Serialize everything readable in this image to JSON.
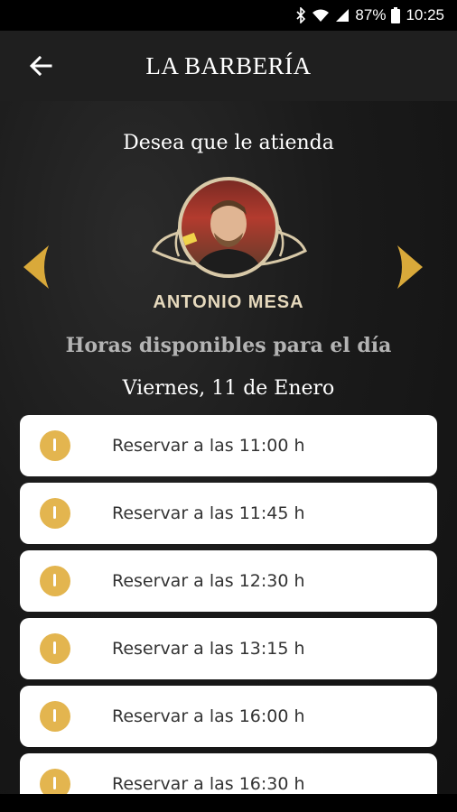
{
  "status_bar": {
    "battery": "87%",
    "time": "10:25",
    "icons": [
      "bluetooth-icon",
      "wifi-icon",
      "signal-icon",
      "battery-icon"
    ]
  },
  "app_bar": {
    "title": "LA BARBERÍA",
    "back_icon": "arrow-left-icon"
  },
  "barber_select": {
    "prompt": "Desea que le atienda",
    "name": "ANTONIO MESA",
    "prev_icon": "chevron-left-icon",
    "next_icon": "chevron-right-icon"
  },
  "availability": {
    "title": "Horas disponibles para el día",
    "day": "Viernes, 11 de Enero"
  },
  "slots": [
    {
      "label": "Reservar a las 11:00 h"
    },
    {
      "label": "Reservar a las 11:45 h"
    },
    {
      "label": "Reservar a las 12:30 h"
    },
    {
      "label": "Reservar a las 13:15 h"
    },
    {
      "label": "Reservar a las 16:00 h"
    },
    {
      "label": "Reservar a las 16:30 h"
    }
  ],
  "colors": {
    "accent_gold": "#e3b54f",
    "app_bar_bg": "#1f1f1f",
    "name_color": "#e6d9bd"
  }
}
